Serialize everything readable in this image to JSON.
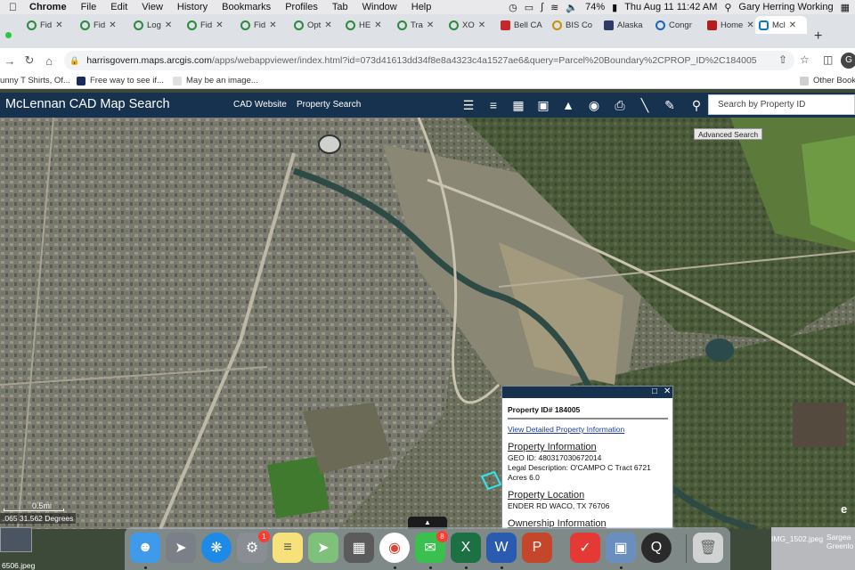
{
  "menubar": {
    "app": "Chrome",
    "items": [
      "File",
      "Edit",
      "View",
      "History",
      "Bookmarks",
      "Profiles",
      "Tab",
      "Window",
      "Help"
    ],
    "battery": "74%",
    "datetime": "Thu Aug 11  11:42 AM",
    "user": "Gary Herring Working"
  },
  "tabs": [
    {
      "label": "Fid",
      "icon": "green-ring-icon"
    },
    {
      "label": "Fid",
      "icon": "green-ring-icon"
    },
    {
      "label": "Log",
      "icon": "green-ring-icon"
    },
    {
      "label": "Fid",
      "icon": "green-ring-icon"
    },
    {
      "label": "Fid",
      "icon": "green-ring-icon"
    },
    {
      "label": "Opt",
      "icon": "green-ring-icon"
    },
    {
      "label": "HE",
      "icon": "green-ring-icon"
    },
    {
      "label": "Tra",
      "icon": "green-ring-icon"
    },
    {
      "label": "XO",
      "icon": "green-ring-icon"
    },
    {
      "label": "Bell CA",
      "icon": "red-square-icon"
    },
    {
      "label": "BIS Co",
      "icon": "yellow-ring-icon"
    },
    {
      "label": "Alaska",
      "icon": "ship-icon"
    },
    {
      "label": "Congr",
      "icon": "blue-ring-icon"
    },
    {
      "label": "Home",
      "icon": "texas-icon"
    },
    {
      "label": "Mcl",
      "icon": "cyan-square-icon",
      "active": true
    }
  ],
  "address": {
    "host": "harrisgovern.maps.arcgis.com",
    "path": "/apps/webappviewer/index.html?id=073d41613dd34f8e8a4323c4a1527ae6&query=Parcel%20Boundary%2CPROP_ID%2C184005"
  },
  "bookmarks": [
    {
      "label": "unny T Shirts, Of...",
      "icon_color": "#888888"
    },
    {
      "label": "Free way to see if...",
      "icon_color": "#1a2a5a"
    },
    {
      "label": "May be an image...",
      "icon_color": "#e0e0e0"
    }
  ],
  "bookmarks_other": "Other Book",
  "app": {
    "title": "McLennan CAD Map Search",
    "links": [
      "CAD Website",
      "Property Search"
    ],
    "search_placeholder": "Search by Property ID",
    "advanced_search": "Advanced Search",
    "toolbar_icons": [
      "layers-icon",
      "legend-list-icon",
      "basemap-grid-icon",
      "bookmark-icon",
      "graduation-cap-icon",
      "eye-icon",
      "print-icon",
      "measure-ruler-icon",
      "draw-icon",
      "search-icon"
    ]
  },
  "map": {
    "scale_label": "0.5mi",
    "coordinates": ".065 31.562 Degrees",
    "basemap_toggle": "▲"
  },
  "popup": {
    "property_id": "Property ID# 184005",
    "view_link": "View Detailed Property Information",
    "info_heading": "Property  Information",
    "geo_id": "GEO ID: 480317030672014",
    "legal": "Legal Description: O'CAMPO C Tract 6721",
    "acres": "Acres 6.0",
    "location_heading": "Property Location",
    "address": "ENDER RD WACO, TX 76706",
    "ownership_heading": "Ownership Information"
  },
  "dock": {
    "apps": [
      "finder-icon",
      "launchpad-icon",
      "safari-icon",
      "system-preferences-icon",
      "notes-icon",
      "maps-icon",
      "calculator-icon",
      "chrome-icon",
      "messages-icon",
      "excel-icon",
      "word-icon",
      "powerpoint-icon",
      "tasks-icon",
      "preview-icon",
      "quicktime-icon",
      "trash-icon"
    ],
    "badges": {
      "system_preferences": "1",
      "messages": "8"
    }
  },
  "desktop": {
    "left_file": "6506.jpeg",
    "right_file": "IMG_1502.jpeg",
    "right_label": "Sargea Greenlo"
  }
}
